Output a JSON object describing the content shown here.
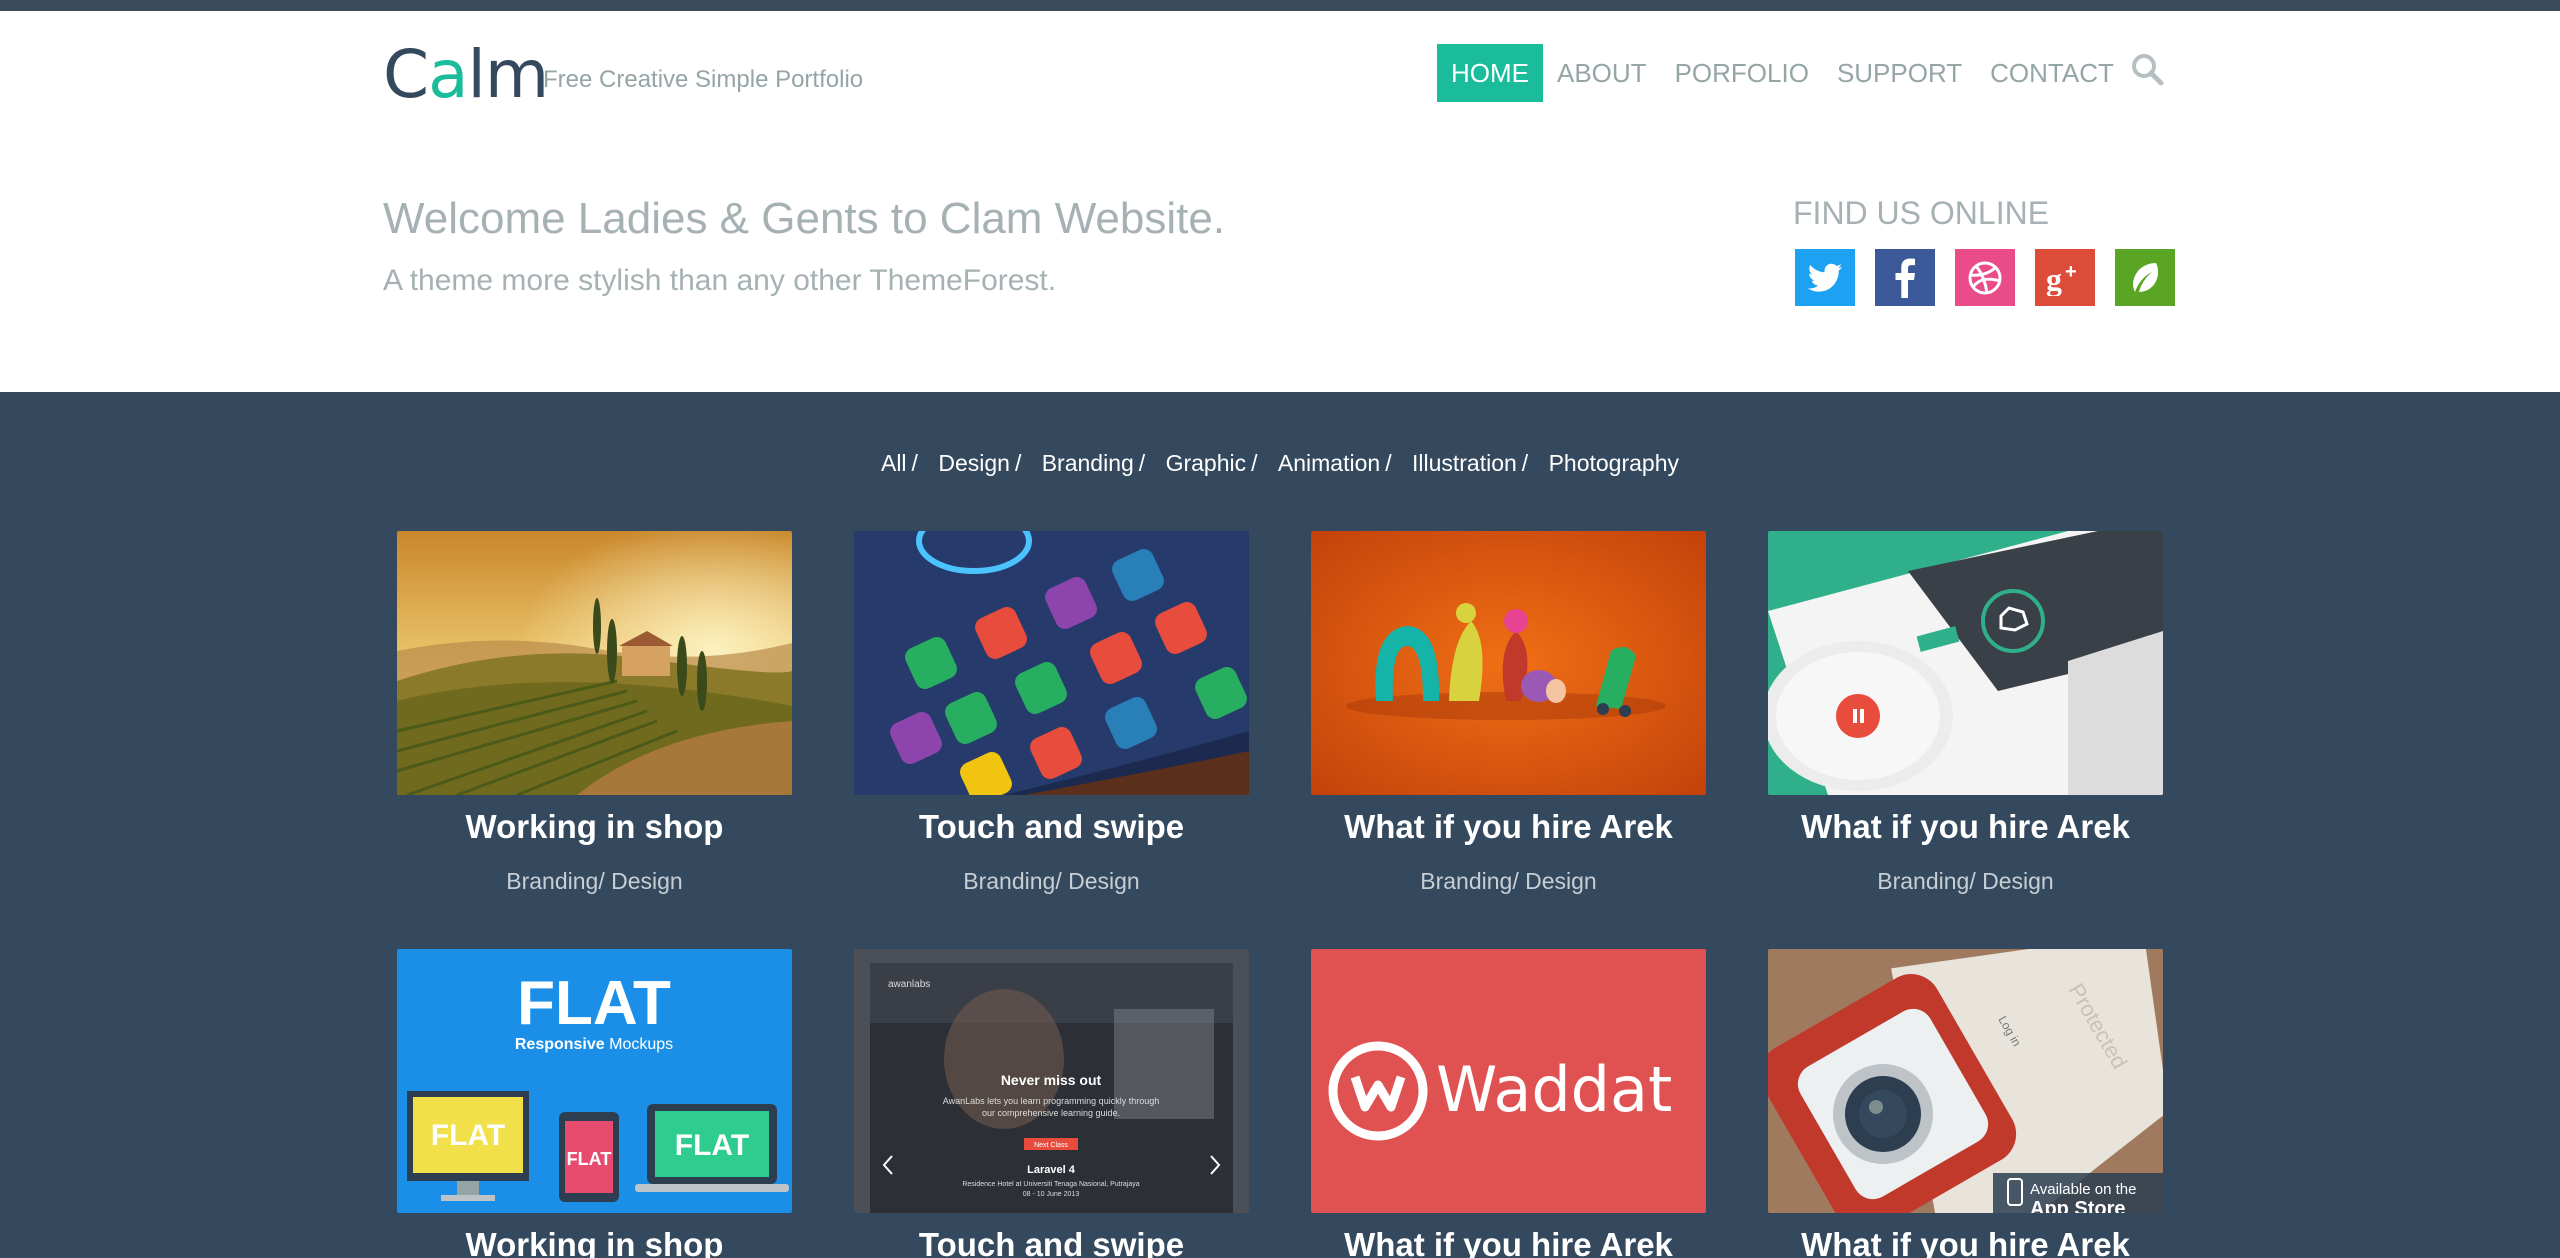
{
  "logo": {
    "text_a": "C",
    "text_accent": "a",
    "text_b": "lm",
    "tagline": "Free Creative Simple Portfolio"
  },
  "nav": {
    "items": [
      {
        "label": "HOME",
        "active": true
      },
      {
        "label": "ABOUT"
      },
      {
        "label": "PORFOLIO"
      },
      {
        "label": "SUPPORT"
      },
      {
        "label": "CONTACT"
      }
    ],
    "search_icon": "search-icon"
  },
  "intro": {
    "headline": "Welcome Ladies & Gents to Clam Website.",
    "subheadline": "A theme more stylish than any other ThemeForest."
  },
  "social": {
    "title": "FIND US ONLINE",
    "items": [
      {
        "name": "twitter-icon",
        "color": "#1da1f2"
      },
      {
        "name": "facebook-icon",
        "color": "#3b5998"
      },
      {
        "name": "dribbble-icon",
        "color": "#ea4c89"
      },
      {
        "name": "google-plus-icon",
        "color": "#dd4b39"
      },
      {
        "name": "evernote-icon",
        "color": "#5ba525"
      }
    ]
  },
  "filters": [
    "All",
    "Design",
    "Branding",
    "Graphic",
    "Animation",
    "Illustration",
    "Photography"
  ],
  "portfolio": [
    {
      "title": "Working in shop",
      "meta": "Branding/ Design",
      "thumb": "vineyard-landscape"
    },
    {
      "title": "Touch and swipe",
      "meta": "Branding/ Design",
      "thumb": "phone-app-icons"
    },
    {
      "title": "What if you hire Arek",
      "meta": "Branding/ Design",
      "thumb": "clay-letters"
    },
    {
      "title": "What if you hire Arek",
      "meta": "Branding/ Design",
      "thumb": "phone-app-ui"
    },
    {
      "title": "Working in shop",
      "meta": "",
      "thumb": "flat-mockups",
      "text": {
        "big": "FLAT",
        "sub_a": "Responsive",
        "sub_b": " Mockups",
        "screen": "FLAT"
      }
    },
    {
      "title": "Touch and swipe",
      "meta": "",
      "thumb": "website-slider",
      "text": {
        "brand": "awanlabs",
        "heading": "Never miss out",
        "body_a": "AwanLabs lets you learn programming quickly through",
        "body_b": "our comprehensive learning guide.",
        "button": "Next Class",
        "event": "Laravel 4",
        "venue": "Residence Hotel at Universiti Tenaga Nasional, Putrajaya",
        "date": "08 - 10 June 2013"
      }
    },
    {
      "title": "What if you hire Arek",
      "meta": "",
      "thumb": "waddat-logo",
      "text": {
        "brand": "Waddat"
      }
    },
    {
      "title": "What if you hire Arek",
      "meta": "",
      "thumb": "camera-app",
      "text": {
        "badge": "Available on the",
        "store": "App Store",
        "stamp": "Protected",
        "login": "Log in"
      }
    }
  ]
}
